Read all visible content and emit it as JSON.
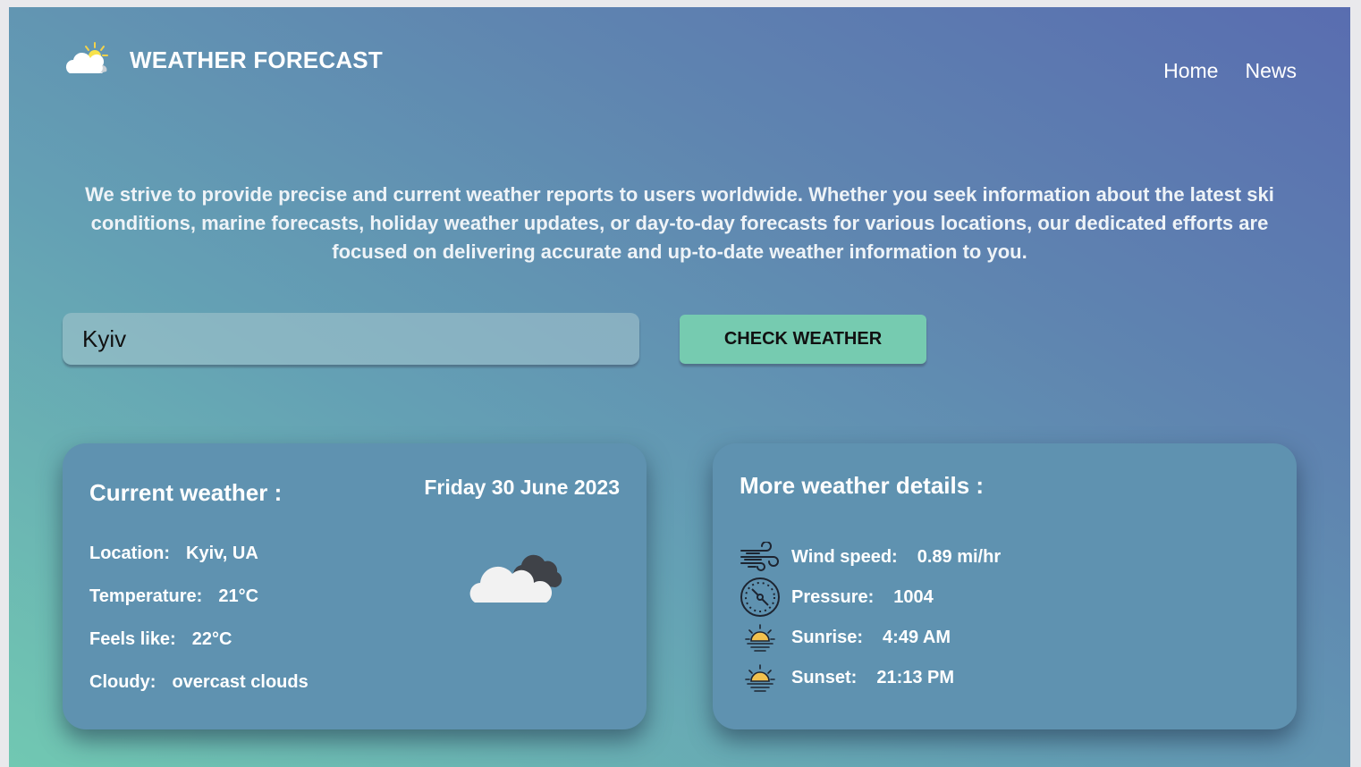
{
  "header": {
    "brand": "WEATHER FORECAST",
    "logo_icon": "sun-cloud-icon",
    "nav": [
      "Home",
      "News"
    ]
  },
  "intro": {
    "text": "We strive to provide precise and current weather reports to users worldwide. Whether you seek information about the latest ski conditions, marine forecasts, holiday weather updates, or day-to-day forecasts for various locations, our dedicated efforts are focused on delivering accurate and up-to-date weather information to you."
  },
  "search": {
    "value": "Kyiv",
    "button_label": "CHECK WEATHER"
  },
  "current": {
    "title": "Current weather :",
    "date": "Friday 30 June 2023",
    "icon": "overcast-clouds-icon",
    "rows": [
      {
        "label": "Location:",
        "value": "Kyiv, UA"
      },
      {
        "label": "Temperature:",
        "value": "21°C"
      },
      {
        "label": "Feels like:",
        "value": "22°C"
      },
      {
        "label": "Cloudy:",
        "value": "overcast clouds"
      }
    ]
  },
  "details": {
    "title": "More weather details :",
    "rows": [
      {
        "icon": "wind-icon",
        "label": "Wind speed:",
        "value": "0.89 mi/hr"
      },
      {
        "icon": "compass-icon",
        "label": "Pressure:",
        "value": "1004"
      },
      {
        "icon": "sunrise-icon",
        "label": "Sunrise:",
        "value": "4:49 AM"
      },
      {
        "icon": "sunset-icon",
        "label": "Sunset:",
        "value": "21:13 PM"
      }
    ]
  },
  "colors": {
    "accent_button": "#76cbb0",
    "card": "#5f92b0",
    "sun": "#f2c14e"
  }
}
